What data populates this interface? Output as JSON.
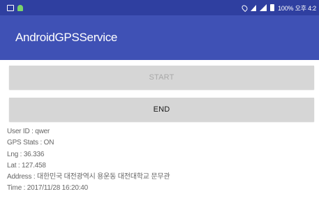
{
  "status_bar": {
    "right_text": "100% 오후 4:2",
    "icons": [
      "image-icon",
      "android-icon",
      "location-icon",
      "wifi-icon",
      "signal-icon",
      "battery-icon"
    ]
  },
  "app_bar": {
    "title": "AndroidGPSService",
    "color": "#3f51b5"
  },
  "buttons": {
    "start_label": "START",
    "end_label": "END"
  },
  "info": {
    "user_id": "User ID : qwer",
    "gps_stats": "GPS Stats : ON",
    "lng": "Lng : 36.336",
    "lat": "Lat : 127.458",
    "address": "Address : 대한민국 대전광역시 용운동 대전대학교 문무관",
    "time": "Time : 2017/11/28 16:20:40"
  }
}
